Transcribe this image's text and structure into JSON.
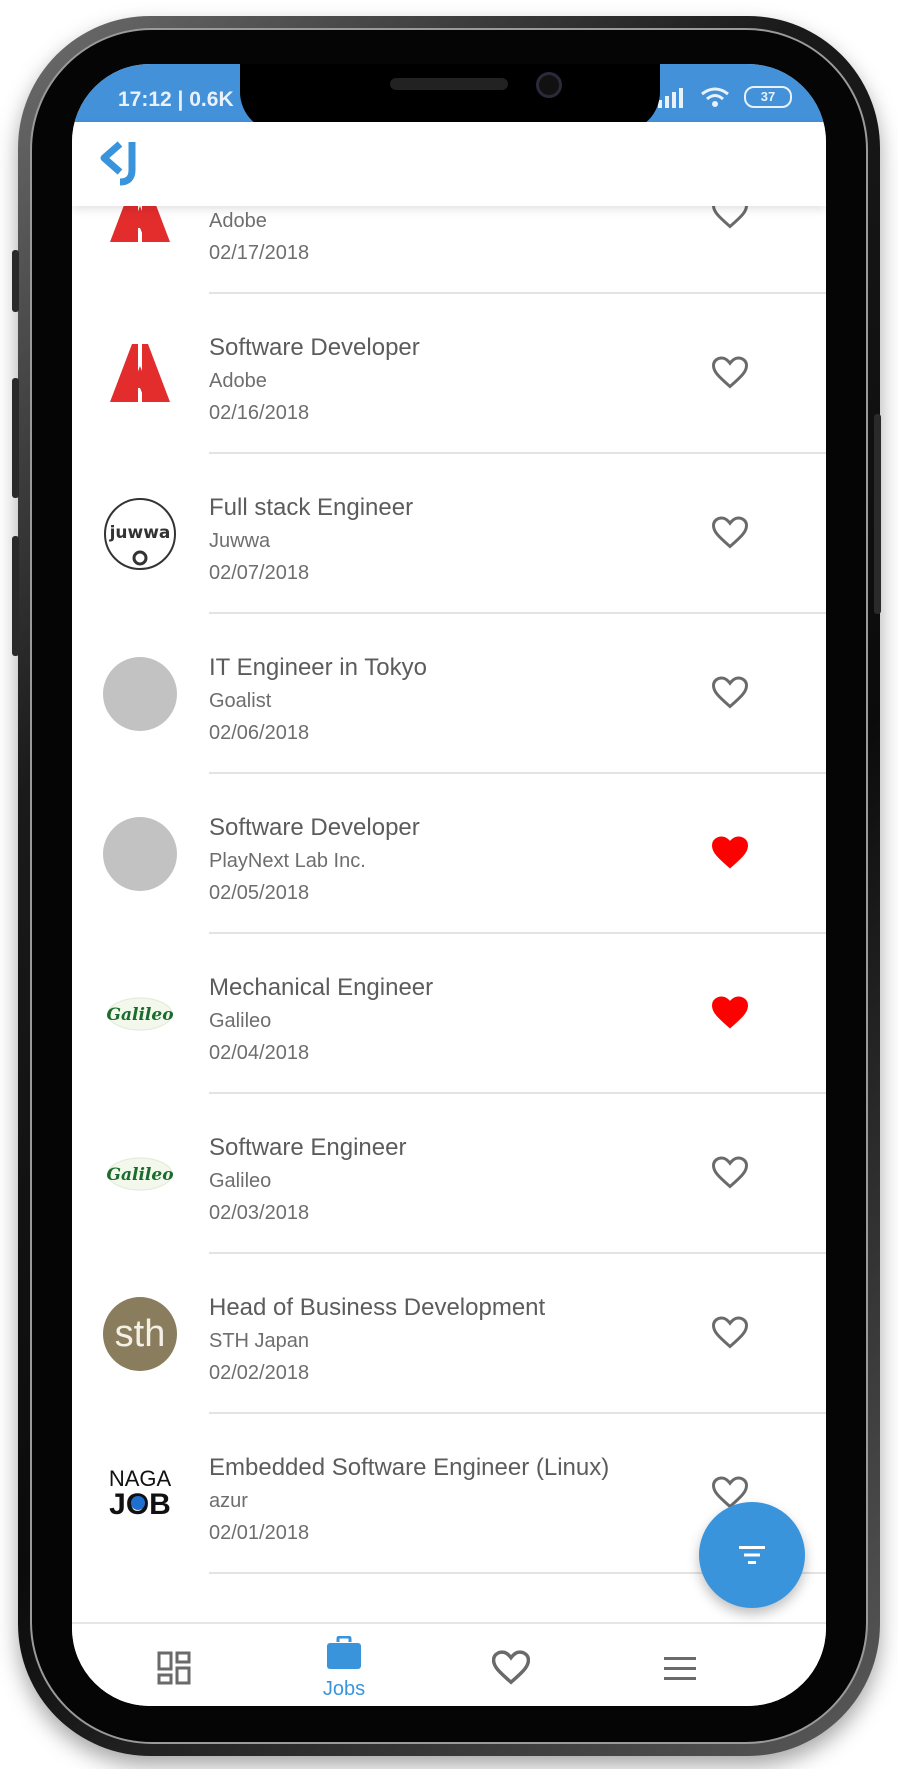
{
  "status_bar": {
    "time": "17:12 | 0.6K",
    "battery": "37"
  },
  "appbar": {
    "logo_icon": "jobs-app-logo-icon"
  },
  "jobs": [
    {
      "title": "",
      "company": "Adobe",
      "date": "02/17/2018",
      "logo": "adobe",
      "favorite": false
    },
    {
      "title": "Software Developer",
      "company": "Adobe",
      "date": "02/16/2018",
      "logo": "adobe",
      "favorite": false
    },
    {
      "title": "Full stack Engineer",
      "company": "Juwwa",
      "date": "02/07/2018",
      "logo": "juwwa",
      "logo_text": "juwwa",
      "favorite": false
    },
    {
      "title": "IT Engineer in Tokyo",
      "company": "Goalist",
      "date": "02/06/2018",
      "logo": "placeholder",
      "favorite": false
    },
    {
      "title": "Software Developer",
      "company": "PlayNext Lab Inc.",
      "date": "02/05/2018",
      "logo": "placeholder",
      "favorite": true
    },
    {
      "title": "Mechanical Engineer",
      "company": "Galileo",
      "date": "02/04/2018",
      "logo": "galileo",
      "logo_text": "Galileo",
      "favorite": true
    },
    {
      "title": "Software Engineer",
      "company": "Galileo",
      "date": "02/03/2018",
      "logo": "galileo",
      "logo_text": "Galileo",
      "favorite": false
    },
    {
      "title": "Head of Business Development",
      "company": "STH Japan",
      "date": "02/02/2018",
      "logo": "sth",
      "logo_text": "sth",
      "favorite": false
    },
    {
      "title": "Embedded Software Engineer (Linux)",
      "company": "azur",
      "date": "02/01/2018",
      "logo": "nagajob",
      "logo_text_top": "NAGA",
      "logo_text_bottom": "JOB",
      "favorite": false
    }
  ],
  "fab": {
    "icon": "filter-icon"
  },
  "bottom_nav": [
    {
      "name": "dashboard",
      "label": "",
      "icon": "dashboard-icon",
      "active": false
    },
    {
      "name": "jobs",
      "label": "Jobs",
      "icon": "briefcase-icon",
      "active": true
    },
    {
      "name": "favorites",
      "label": "",
      "icon": "heart-icon",
      "active": false
    },
    {
      "name": "menu",
      "label": "",
      "icon": "menu-icon",
      "active": false
    }
  ],
  "colors": {
    "accent": "#3a94dc",
    "favorite": "#ff0000",
    "status_bar": "#4391d9",
    "adobe": "#e32d2d",
    "galileo": "#1a6b2c",
    "sth": "#8a7d5e"
  }
}
